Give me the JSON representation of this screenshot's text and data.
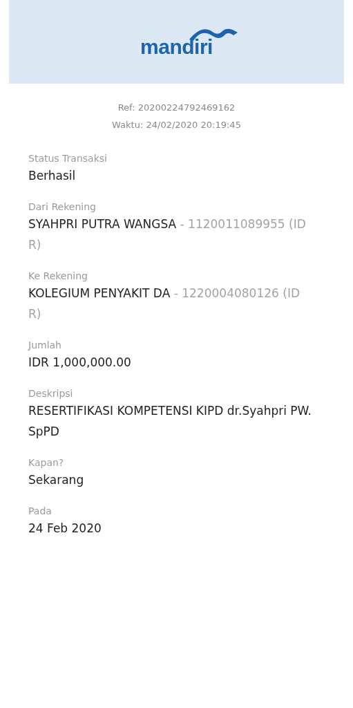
{
  "header": {
    "logo": "mandiri"
  },
  "ref": "Ref: 20200224792469162",
  "time": "Waktu: 24/02/2020 20:19:45",
  "fields": [
    {
      "label": "Status Transaksi",
      "value": "Berhasil"
    },
    {
      "label": "Dari Rekening",
      "value": "SYAHPRI PUTRA WANGSA",
      "account": "- 1120011089955 (IDR)"
    },
    {
      "label": "Ke Rekening",
      "value": "KOLEGIUM PENYAKIT DA",
      "account": "- 1220004080126 (IDR)"
    },
    {
      "label": "Jumlah",
      "value": "IDR 1,000,000.00"
    },
    {
      "label": "Deskripsi",
      "value": "RESERTIFIKASI KOMPETENSI KIPD dr.Syahpri PW. SpPD"
    },
    {
      "label": "Kapan?",
      "value": "Sekarang"
    },
    {
      "label": "Pada",
      "value": "24 Feb 2020"
    }
  ]
}
